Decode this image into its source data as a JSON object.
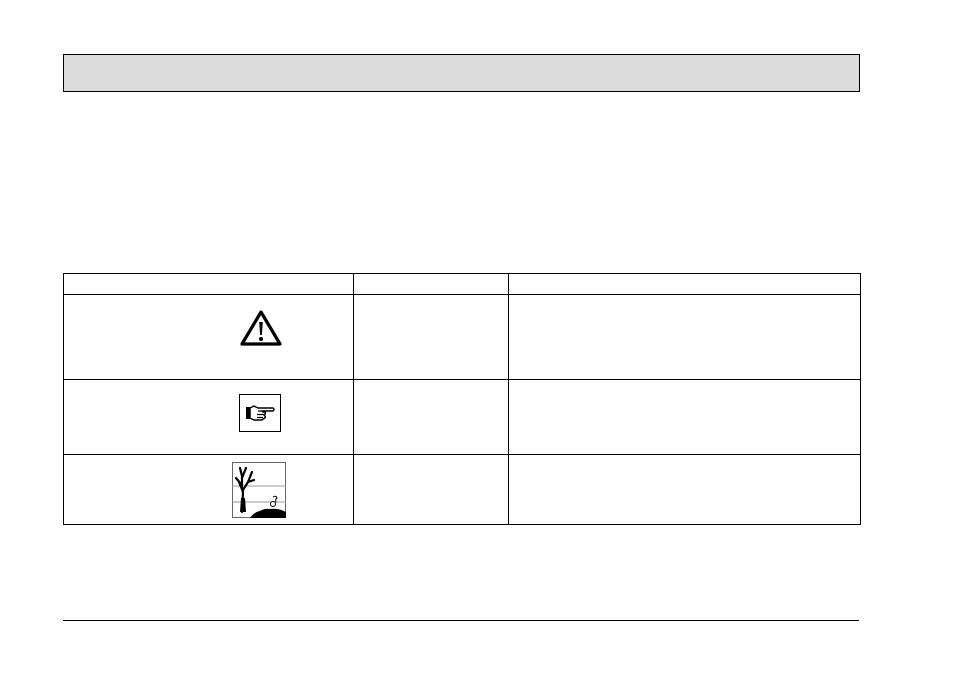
{
  "header": {
    "title": ""
  },
  "table": {
    "columns": [
      "",
      "",
      ""
    ],
    "rows": [
      {
        "icon": "warning-triangle-icon",
        "meaning": "",
        "description": ""
      },
      {
        "icon": "pointing-hand-note-icon",
        "meaning": "",
        "description": ""
      },
      {
        "icon": "environment-tree-icon",
        "meaning": "",
        "description": ""
      }
    ]
  }
}
